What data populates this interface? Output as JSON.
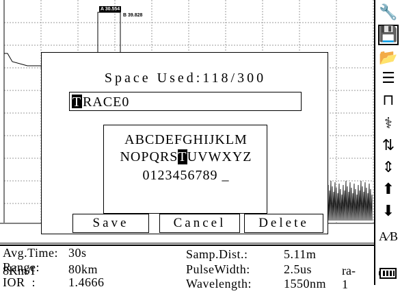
{
  "markers": {
    "a": "A 30.554",
    "b": "B 39.828"
  },
  "dialog": {
    "title": "Space Used:118/300",
    "name_cursor_char": "T",
    "name_rest": "RACE0",
    "keyboard": {
      "row1": "ABCDEFGHIJKLM",
      "row2_before": "NOPQRS",
      "row2_selected": "T",
      "row2_after": "UVWXYZ",
      "row3": "0123456789 _"
    },
    "buttons": {
      "save": "Save",
      "cancel": "Cancel",
      "delete": "Delete"
    }
  },
  "status": {
    "left": "8Km/I",
    "right": "ra-1"
  },
  "info": {
    "avg_time_label": "Avg.Time:",
    "avg_time_value": "30s",
    "range_label": "Range:",
    "range_value": "80km",
    "ior_label": "IOR  :",
    "ior_value": "1.4666",
    "samp_label": "Samp.Dist.:",
    "samp_value": "5.11m",
    "pulse_label": "PulseWidth:",
    "pulse_value": "2.5us",
    "wave_label": "Wavelength:",
    "wave_value": "1550nm"
  },
  "sidebar": {
    "icons": [
      "wrench-icon",
      "save-disk-icon",
      "folder-open-icon",
      "document-list-icon",
      "pulse-expand-icon",
      "zoom-vertical-icon",
      "marker-move-icon",
      "marker-fine-icon",
      "arrow-up-icon",
      "arrow-down-icon",
      "ab-marker-icon",
      "battery-icon"
    ]
  }
}
